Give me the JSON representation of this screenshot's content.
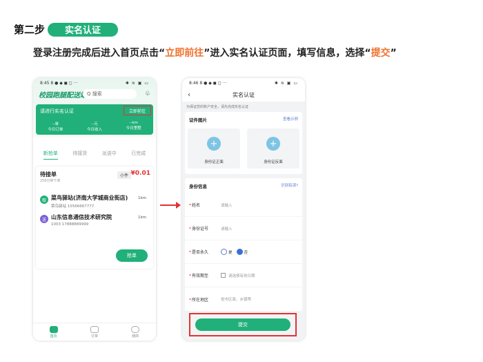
{
  "header": {
    "step_label": "第二步",
    "step_pill": "实名认证",
    "instruction_parts": [
      "登录注册完成后进入首页点击“",
      "立即前往",
      "”进入实名认证页面，填写信息，选择“",
      "提交",
      "”"
    ]
  },
  "phone1": {
    "status_time": "8:45 8 ● ◆ ◼ ◻ ···",
    "status_icons": "✱ ≋ ▣ ▭",
    "logo": "校园跑腿配送端",
    "search_placeholder": "Q 搜索",
    "bell": "♧",
    "card_title": "请进行实名认证",
    "card_button": "立即前往",
    "stats": [
      {
        "value": "--单",
        "label": "今日订单"
      },
      {
        "value": "--元",
        "label": "今日收入"
      },
      {
        "value": "--km",
        "label": "今日里程"
      }
    ],
    "tabs": [
      "新抢单",
      "待接货",
      "派送中",
      "已完成"
    ],
    "order": {
      "title": "待接单",
      "time": "256分钟下单",
      "size": "小件",
      "price": "¥0.01",
      "pickup": {
        "dot": "取",
        "name": "菜鸟驿站(济南大学城商业街店)",
        "sub": "菜鸟驿站 15566667777",
        "km": "1km"
      },
      "dropoff": {
        "dot": "送",
        "name": "山东信息通信技术研究院",
        "sub": "1003 17888889999",
        "km": "1km"
      },
      "grab": "抢单"
    },
    "nav": [
      "首页",
      "订单",
      "我的"
    ]
  },
  "phone2": {
    "status_time": "8:46 8 ● ◆ ◼ ◻ ···",
    "status_icons": "✱ ≋ ▣ ▭",
    "back": "‹",
    "title": "实名认证",
    "notice": "为保证您的账户安全，请先完成实名认证",
    "id_section": {
      "title": "证件图片",
      "link": "查看示例",
      "front": "身份证正面",
      "back": "身份证反面"
    },
    "info_section": {
      "title": "身份信息",
      "link": "识别有误?"
    },
    "fields": {
      "name_label": "姓名",
      "name_ph": "请输入",
      "id_label": "身份证号",
      "id_ph": "请输入",
      "perm_label": "是否永久",
      "perm_yes": "是",
      "perm_no": "否",
      "valid_label": "有效期至",
      "valid_ph": "请选择有效日期",
      "area_label": "所在地区",
      "area_ph": "省市区县、乡镇等"
    },
    "submit": "提交"
  },
  "colors": {
    "green": "#21b07a",
    "red": "#e23232",
    "orange": "#f0702a"
  }
}
